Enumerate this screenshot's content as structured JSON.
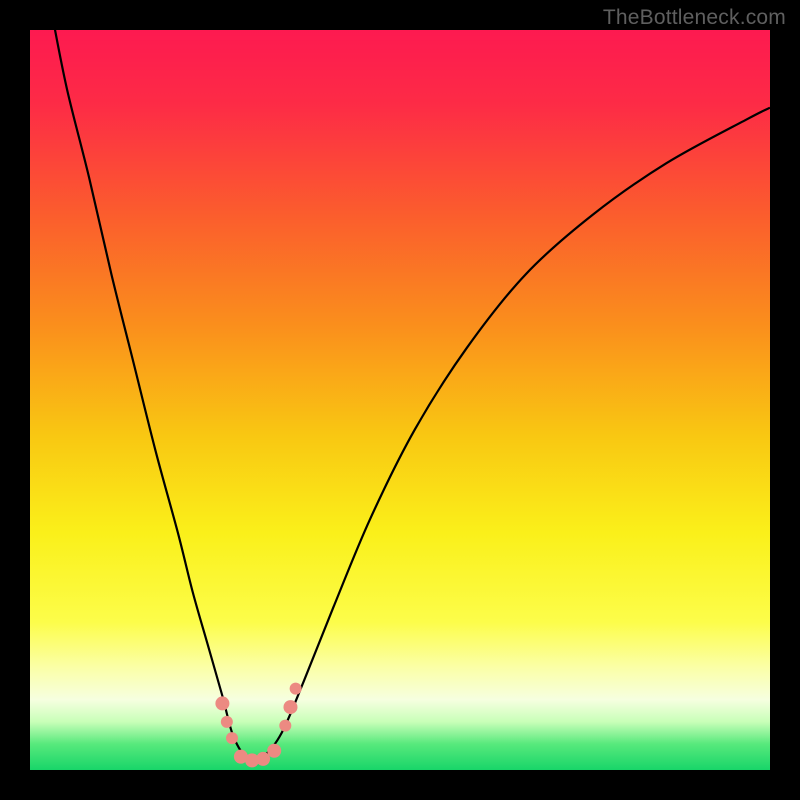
{
  "watermark": "TheBottleneck.com",
  "colors": {
    "frame": "#000000",
    "gradient_stops": [
      {
        "offset": 0.0,
        "color": "#fd1a50"
      },
      {
        "offset": 0.1,
        "color": "#fd2b46"
      },
      {
        "offset": 0.25,
        "color": "#fb5d2d"
      },
      {
        "offset": 0.4,
        "color": "#fa8f1c"
      },
      {
        "offset": 0.55,
        "color": "#f9c812"
      },
      {
        "offset": 0.68,
        "color": "#faf01a"
      },
      {
        "offset": 0.8,
        "color": "#fcfd4a"
      },
      {
        "offset": 0.86,
        "color": "#fbffa5"
      },
      {
        "offset": 0.905,
        "color": "#f6ffe0"
      },
      {
        "offset": 0.935,
        "color": "#c8ffb8"
      },
      {
        "offset": 0.965,
        "color": "#57e97c"
      },
      {
        "offset": 1.0,
        "color": "#18d569"
      }
    ],
    "curve": "#000000",
    "marker_fill": "#ec8a82",
    "marker_stroke": "#d86a60"
  },
  "chart_data": {
    "type": "line",
    "title": "",
    "xlabel": "",
    "ylabel": "",
    "xlim": [
      0,
      100
    ],
    "ylim": [
      0,
      100
    ],
    "grid": false,
    "series": [
      {
        "name": "curve",
        "x": [
          3.0,
          5,
          8,
          11,
          14,
          17,
          20,
          22,
          24,
          26,
          27.5,
          29.5,
          31.5,
          34,
          37,
          41,
          46,
          52,
          59,
          67,
          76,
          86,
          97,
          100
        ],
        "values": [
          102,
          92,
          80,
          67,
          55,
          43,
          32,
          24,
          17,
          10,
          4.5,
          1.5,
          1.8,
          5,
          12,
          22,
          34,
          46,
          57,
          67,
          75,
          82,
          88,
          89.5
        ]
      }
    ],
    "markers": [
      {
        "x": 26.0,
        "y": 9.0,
        "r": 7
      },
      {
        "x": 26.6,
        "y": 6.5,
        "r": 6
      },
      {
        "x": 27.3,
        "y": 4.3,
        "r": 6
      },
      {
        "x": 28.5,
        "y": 1.8,
        "r": 7
      },
      {
        "x": 30.0,
        "y": 1.3,
        "r": 7
      },
      {
        "x": 31.5,
        "y": 1.5,
        "r": 7
      },
      {
        "x": 33.0,
        "y": 2.6,
        "r": 7
      },
      {
        "x": 34.5,
        "y": 6.0,
        "r": 6
      },
      {
        "x": 35.2,
        "y": 8.5,
        "r": 7
      },
      {
        "x": 35.9,
        "y": 11.0,
        "r": 6
      }
    ],
    "notch_x": 30
  }
}
